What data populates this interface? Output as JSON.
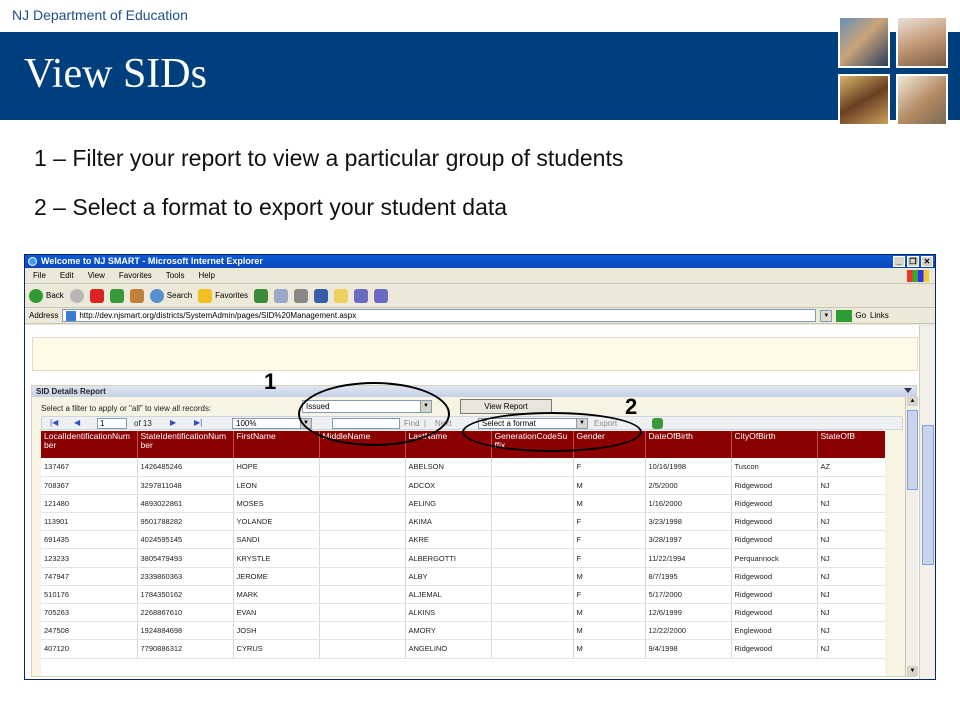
{
  "slide": {
    "org": "NJ Department of Education",
    "title": "View SIDs",
    "bullets": [
      "1 – Filter your report to view a particular group of students",
      "2 – Select a format to export your student data"
    ],
    "callouts": [
      "1",
      "2"
    ]
  },
  "browser": {
    "title": "Welcome to NJ SMART - Microsoft Internet Explorer",
    "menu": [
      "File",
      "Edit",
      "View",
      "Favorites",
      "Tools",
      "Help"
    ],
    "toolbar": {
      "back": "Back",
      "search": "Search",
      "favorites": "Favorites"
    },
    "address_label": "Address",
    "url": "http://dev.njsmart.org/districts/SystemAdmin/pages/SID%20Management.aspx",
    "go": "Go",
    "links": "Links",
    "window_buttons": [
      "_",
      "❐",
      "✕"
    ]
  },
  "report": {
    "header": "SID Details Report",
    "filter_label": "Select a filter to apply or \"all\" to view all records:",
    "filter_value": "Issued",
    "view_button": "View Report",
    "page_value": "1",
    "page_of": "of 13",
    "zoom": "100%",
    "find_label": "Find",
    "next_label": "Next",
    "export_format": "Select a format",
    "export_button": "Export",
    "columns": [
      "LocalIdentificationNumber",
      "StateIdentificationNumber",
      "FirstName",
      "MiddleName",
      "LastName",
      "GenerationCodeSuffix",
      "Gender",
      "DateOfBirth",
      "CityOfBirth",
      "StateOfB"
    ],
    "rows": [
      [
        "137467",
        "1426485246",
        "HOPE",
        "",
        "ABELSON",
        "",
        "F",
        "10/16/1998",
        "Tuscon",
        "AZ"
      ],
      [
        "708367",
        "3297811048",
        "LEON",
        "",
        "ADCOX",
        "",
        "M",
        "2/5/2000",
        "Ridgewood",
        "NJ"
      ],
      [
        "121480",
        "4893022861",
        "MOSES",
        "",
        "AELING",
        "",
        "M",
        "1/16/2000",
        "Ridgewood",
        "NJ"
      ],
      [
        "113901",
        "9501788282",
        "YOLANDE",
        "",
        "AKIMA",
        "",
        "F",
        "3/23/1998",
        "Ridgewood",
        "NJ"
      ],
      [
        "691435",
        "4024595145",
        "SANDI",
        "",
        "AKRE",
        "",
        "F",
        "3/28/1997",
        "Ridgewood",
        "NJ"
      ],
      [
        "123233",
        "3805479493",
        "KRYSTLE",
        "",
        "ALBERGOTTI",
        "",
        "F",
        "11/22/1994",
        "Perquannock",
        "NJ"
      ],
      [
        "747947",
        "2339860363",
        "JEROME",
        "",
        "ALBY",
        "",
        "M",
        "8/7/1995",
        "Ridgewood",
        "NJ"
      ],
      [
        "510176",
        "1784350162",
        "MARK",
        "",
        "ALJEMAL",
        "",
        "F",
        "5/17/2000",
        "Ridgewood",
        "NJ"
      ],
      [
        "705263",
        "2268867610",
        "EVAN",
        "",
        "ALKINS",
        "",
        "M",
        "12/6/1999",
        "Ridgewood",
        "NJ"
      ],
      [
        "247508",
        "1924884698",
        "JOSH",
        "",
        "AMORY",
        "",
        "M",
        "12/22/2000",
        "Englewood",
        "NJ"
      ],
      [
        "407120",
        "7790886312",
        "CYRUS",
        "",
        "ANGELINO",
        "",
        "M",
        "9/4/1998",
        "Ridgewood",
        "NJ"
      ]
    ]
  }
}
